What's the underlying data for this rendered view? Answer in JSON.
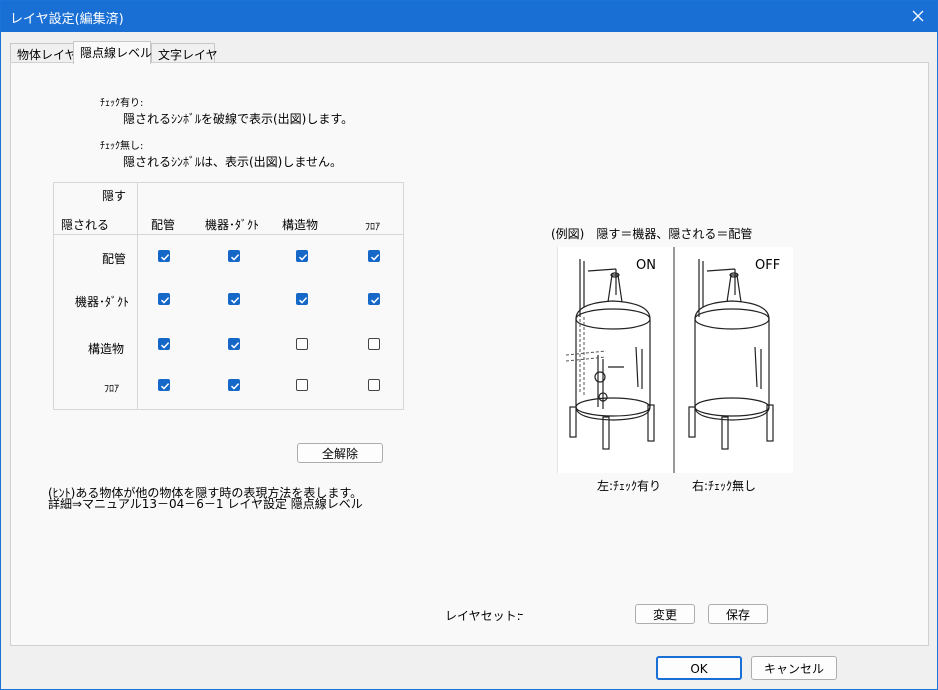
{
  "window": {
    "title": "レイヤ設定(編集済)",
    "close_glyph": "✕"
  },
  "tabs": [
    {
      "label": "物体レイヤ",
      "active": false
    },
    {
      "label": "隠点線レベル",
      "active": true
    },
    {
      "label": "文字レイヤ",
      "active": false
    }
  ],
  "legend": {
    "checked_heading": "ﾁｪｯｸ有り:",
    "checked_desc": "隠されるｼﾝﾎﾞﾙを破線で表示(出図)します。",
    "unchecked_heading": "ﾁｪｯｸ無し:",
    "unchecked_desc": "隠されるｼﾝﾎﾞﾙは、表示(出図)しません。"
  },
  "matrix": {
    "hide_label": "隠す",
    "hidden_label": "隠される",
    "columns": [
      "配管",
      "機器･ﾀﾞｸﾄ",
      "構造物",
      "ﾌﾛｱ"
    ],
    "rows": [
      {
        "label": "配管",
        "values": [
          true,
          true,
          true,
          true
        ]
      },
      {
        "label": "機器･ﾀﾞｸﾄ",
        "values": [
          true,
          true,
          true,
          true
        ]
      },
      {
        "label": "構造物",
        "values": [
          true,
          true,
          false,
          false
        ]
      },
      {
        "label": "ﾌﾛｱ",
        "values": [
          true,
          true,
          false,
          false
        ]
      }
    ],
    "clear_all_label": "全解除"
  },
  "hint": {
    "line1": "(ﾋﾝﾄ)ある物体が他の物体を隠す時の表現方法を表します。",
    "line2": "詳細⇒マニュアル13－04－6－1 レイヤ設定 隠点線レベル"
  },
  "example": {
    "caption": "(例図)　隠す＝機器、隠される＝配管",
    "on_label": "ON",
    "off_label": "OFF",
    "left_caption": "左:ﾁｪｯｸ有り",
    "right_caption": "右:ﾁｪｯｸ無し"
  },
  "layerset": {
    "label": "レイヤセット:",
    "value": "-",
    "change_label": "変更",
    "save_label": "保存"
  },
  "footer": {
    "ok_label": "OK",
    "cancel_label": "キャンセル"
  },
  "colors": {
    "titlebar": "#1a6fd4",
    "checkbox_on": "#1567c8"
  }
}
